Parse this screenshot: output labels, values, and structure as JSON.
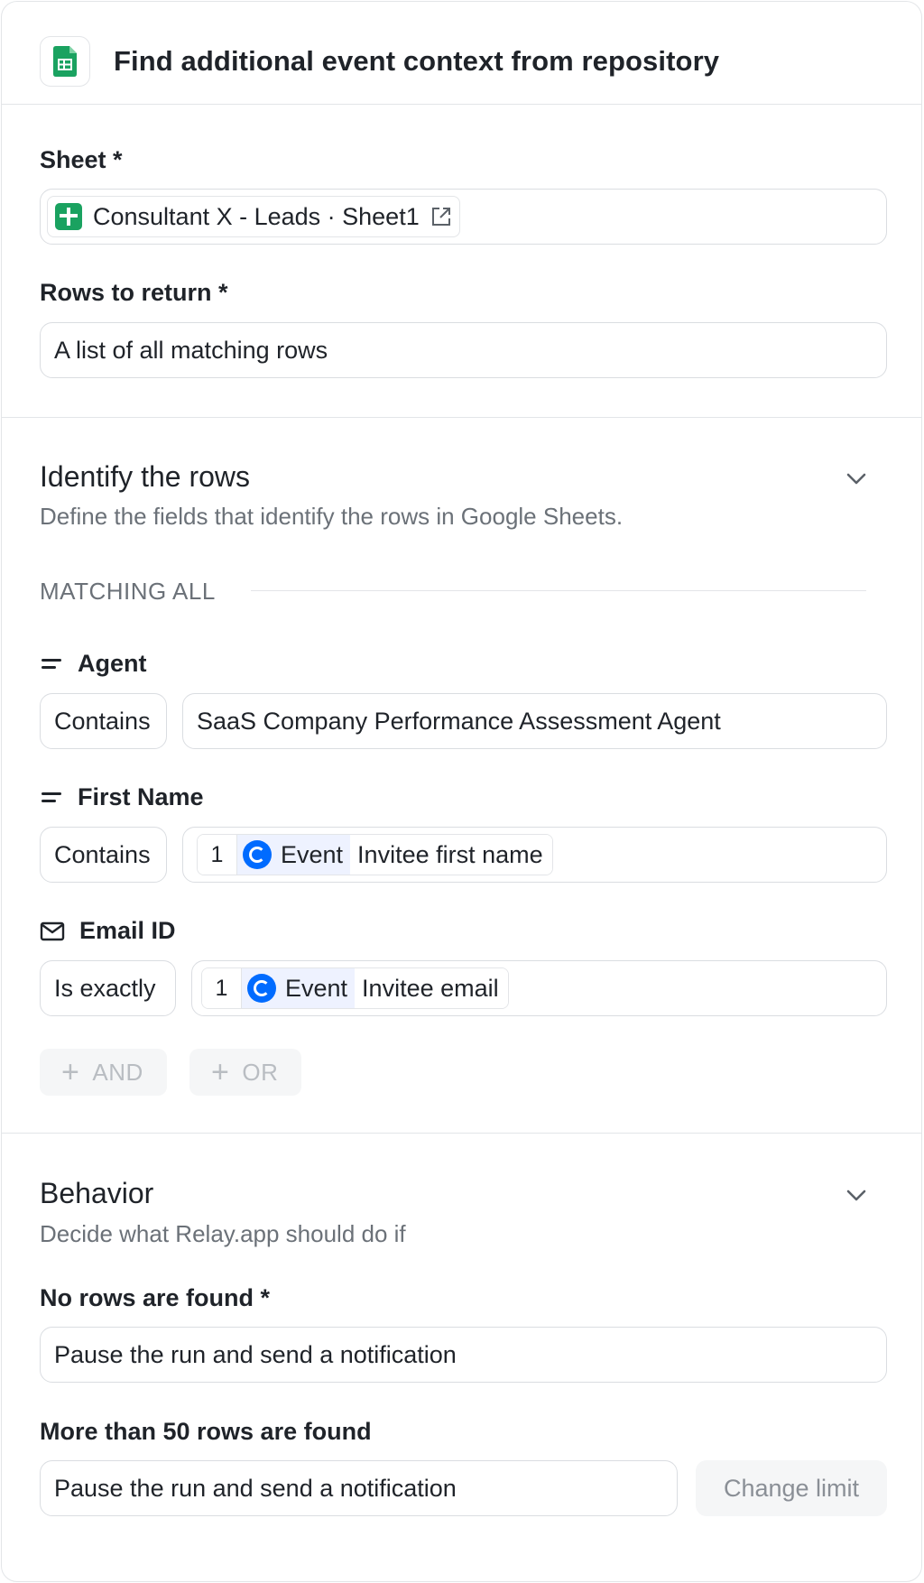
{
  "header": {
    "title": "Find additional event context from repository",
    "icon": "google-sheets-icon"
  },
  "sheet": {
    "label": "Sheet *",
    "value": "Consultant X - Leads · Sheet1"
  },
  "rows_to_return": {
    "label": "Rows to return *",
    "value": "A list of all matching rows"
  },
  "identify": {
    "title": "Identify the rows",
    "subtitle": "Define the fields that identify the rows in Google Sheets.",
    "matching_label": "MATCHING ALL",
    "conditions": [
      {
        "field": "Agent",
        "icon": "equals-icon",
        "operator": "Contains",
        "value": "SaaS Company Performance Assessment Agent"
      },
      {
        "field": "First Name",
        "icon": "equals-icon",
        "operator": "Contains",
        "token": {
          "step": "1",
          "app": "Event",
          "field": "Invitee first name"
        }
      },
      {
        "field": "Email ID",
        "icon": "mail-icon",
        "operator": "Is exactly",
        "token": {
          "step": "1",
          "app": "Event",
          "field": "Invitee email"
        }
      }
    ],
    "and_label": "AND",
    "or_label": "OR"
  },
  "behavior": {
    "title": "Behavior",
    "subtitle": "Decide what Relay.app should do if",
    "no_rows_label": "No rows are found *",
    "no_rows_value": "Pause the run and send a notification",
    "more_rows_label": "More than 50 rows are found",
    "more_rows_value": "Pause the run and send a notification",
    "change_limit_label": "Change limit"
  },
  "colors": {
    "sheets_green": "#1aa260",
    "calendly_blue": "#006bff",
    "token_bg": "#eef2ff"
  }
}
